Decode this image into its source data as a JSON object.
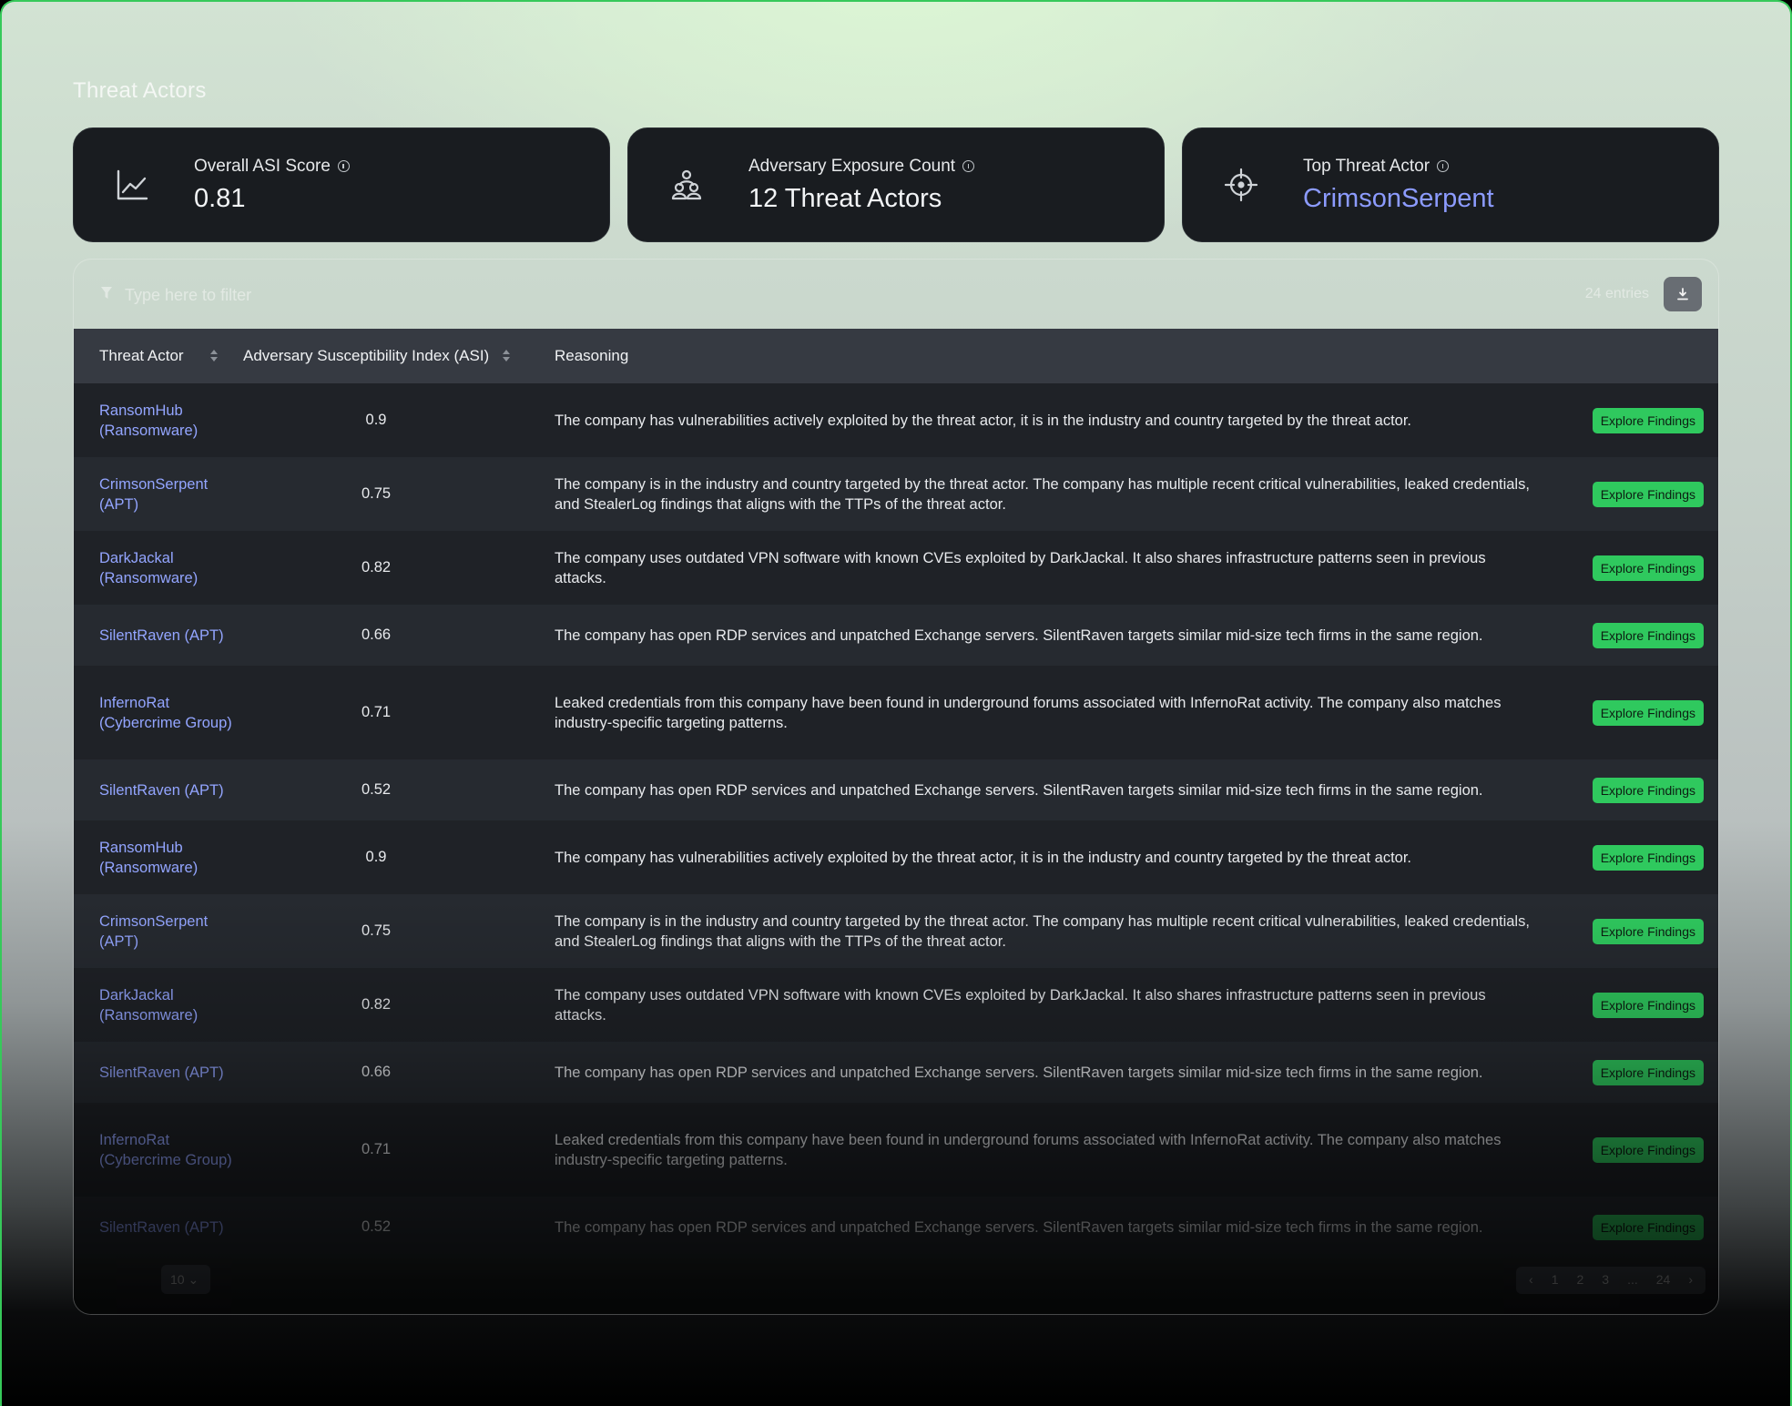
{
  "page": {
    "title": "Threat Actors"
  },
  "cards": [
    {
      "label": "Overall ASI Score",
      "value": "0.81",
      "icon": "line-chart-icon"
    },
    {
      "label": "Adversary Exposure Count",
      "value": "12 Threat Actors",
      "icon": "users-group-icon"
    },
    {
      "label": "Top Threat Actor",
      "value": "CrimsonSerpent",
      "icon": "crosshair-icon",
      "accent": "#8c9bff"
    }
  ],
  "filter": {
    "placeholder": "Type here to filter",
    "entries": "24 entries"
  },
  "table": {
    "columns": [
      "Threat Actor",
      "Adversary Susceptibility Index (ASI)",
      "Reasoning"
    ],
    "action_label": "Explore Findings",
    "rows": [
      {
        "actor": "RansomHub (Ransomware)",
        "asi": "0.9",
        "reasoning": "The company has vulnerabilities actively exploited by the threat actor, it is in the industry and country targeted by the threat actor."
      },
      {
        "actor": "CrimsonSerpent (APT)",
        "asi": "0.75",
        "reasoning": "The company is in the industry and country targeted by the threat actor. The company has multiple recent critical vulnerabilities, leaked credentials, and StealerLog findings that aligns with the TTPs of the threat actor."
      },
      {
        "actor": "DarkJackal (Ransomware)",
        "asi": "0.82",
        "reasoning": "The company uses outdated VPN software with known CVEs exploited by DarkJackal. It also shares infrastructure patterns seen in previous attacks."
      },
      {
        "actor": "SilentRaven (APT)",
        "asi": "0.66",
        "reasoning": "The company has open RDP services and unpatched Exchange servers. SilentRaven targets similar mid-size tech firms in the same region."
      },
      {
        "actor": "InfernoRat (Cybercrime Group)",
        "asi": "0.71",
        "reasoning": "Leaked credentials from this company have been found in underground forums associated with InfernoRat activity. The company also matches industry-specific targeting patterns."
      },
      {
        "actor": "SilentRaven (APT)",
        "asi": "0.52",
        "reasoning": "The company has open RDP services and unpatched Exchange servers. SilentRaven targets similar mid-size tech firms in the same region."
      },
      {
        "actor": "RansomHub (Ransomware)",
        "asi": "0.9",
        "reasoning": "The company has vulnerabilities actively exploited by the threat actor, it is in the industry and country targeted by the threat actor."
      },
      {
        "actor": "CrimsonSerpent (APT)",
        "asi": "0.75",
        "reasoning": "The company is in the industry and country targeted by the threat actor. The company has multiple recent critical vulnerabilities, leaked credentials, and StealerLog findings that aligns with the TTPs of the threat actor."
      },
      {
        "actor": "DarkJackal (Ransomware)",
        "asi": "0.82",
        "reasoning": "The company uses outdated VPN software with known CVEs exploited by DarkJackal. It also shares infrastructure patterns seen in previous attacks."
      },
      {
        "actor": "SilentRaven (APT)",
        "asi": "0.66",
        "reasoning": "The company has open RDP services and unpatched Exchange servers. SilentRaven targets similar mid-size tech firms in the same region."
      },
      {
        "actor": "InfernoRat (Cybercrime Group)",
        "asi": "0.71",
        "reasoning": "Leaked credentials from this company have been found in underground forums associated with InfernoRat activity. The company also matches industry-specific targeting patterns."
      },
      {
        "actor": "SilentRaven (APT)",
        "asi": "0.52",
        "reasoning": "The company has open RDP services and unpatched Exchange servers. SilentRaven targets similar mid-size tech firms in the same region."
      }
    ]
  },
  "pagination": {
    "page_size": "10",
    "pages": [
      "1",
      "2",
      "3",
      "...",
      "24"
    ]
  },
  "colors": {
    "accent": "#8c9bff",
    "action": "#2fc95e",
    "frame": "#36c95a"
  }
}
